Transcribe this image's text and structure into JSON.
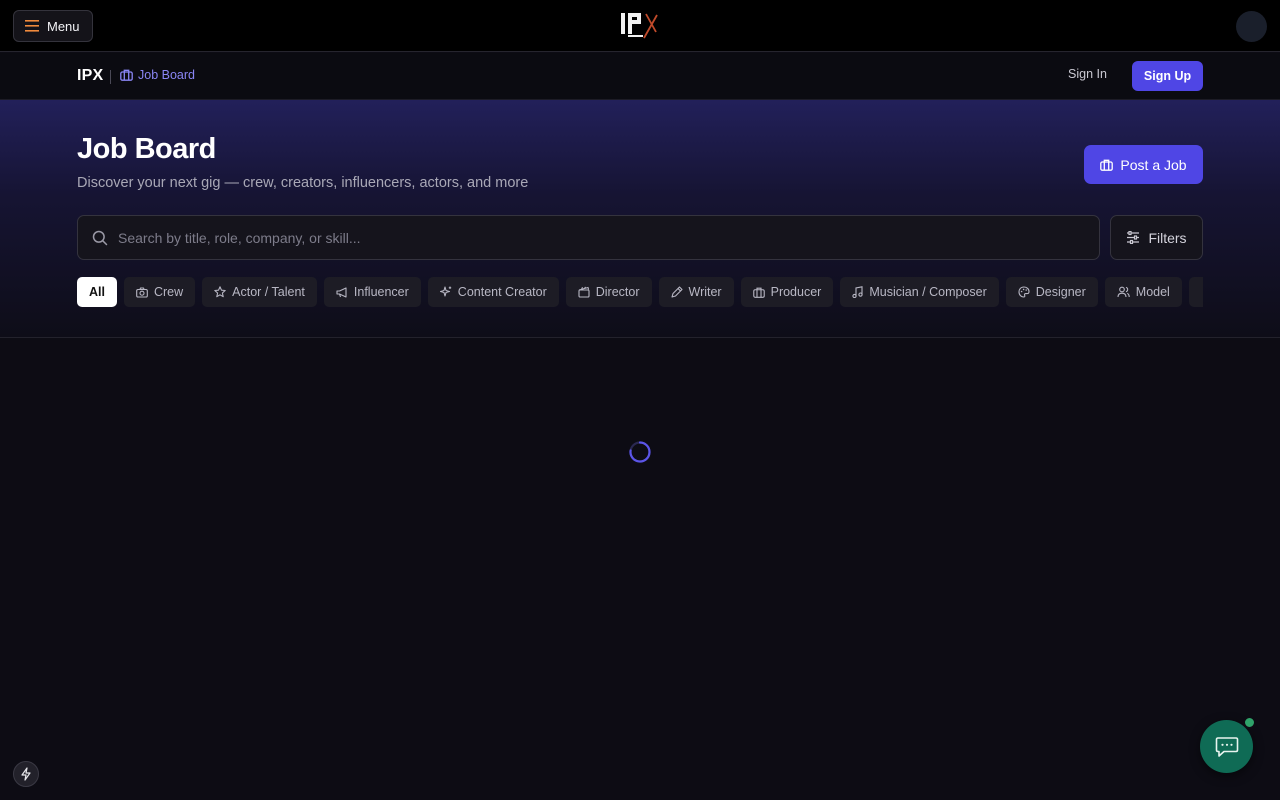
{
  "topbar": {
    "menu_label": "Menu",
    "logo_icon": "ipx-logo"
  },
  "subnav": {
    "brand": "IPX",
    "breadcrumb": "Job Board",
    "sign_in": "Sign In",
    "sign_up": "Sign Up"
  },
  "hero": {
    "title": "Job Board",
    "subtitle": "Discover your next gig — crew, creators, influencers, actors, and more",
    "post_button": "Post a Job"
  },
  "search": {
    "placeholder": "Search by title, role, company, or skill...",
    "value": "",
    "filters_label": "Filters"
  },
  "categories": [
    {
      "label": "All",
      "icon": "none",
      "active": true
    },
    {
      "label": "Crew",
      "icon": "camera-icon"
    },
    {
      "label": "Actor / Talent",
      "icon": "star-icon"
    },
    {
      "label": "Influencer",
      "icon": "megaphone-icon"
    },
    {
      "label": "Content Creator",
      "icon": "sparkles-icon"
    },
    {
      "label": "Director",
      "icon": "clapperboard-icon"
    },
    {
      "label": "Writer",
      "icon": "pen-icon"
    },
    {
      "label": "Producer",
      "icon": "briefcase-icon"
    },
    {
      "label": "Musician / Composer",
      "icon": "music-icon"
    },
    {
      "label": "Designer",
      "icon": "palette-icon"
    },
    {
      "label": "Model",
      "icon": "users-icon"
    }
  ],
  "colors": {
    "accent": "#4f46e5",
    "breadcrumb": "#8a86f5",
    "chat": "#0f6b55",
    "online": "#2fa36a",
    "background": "#0d0c14"
  }
}
